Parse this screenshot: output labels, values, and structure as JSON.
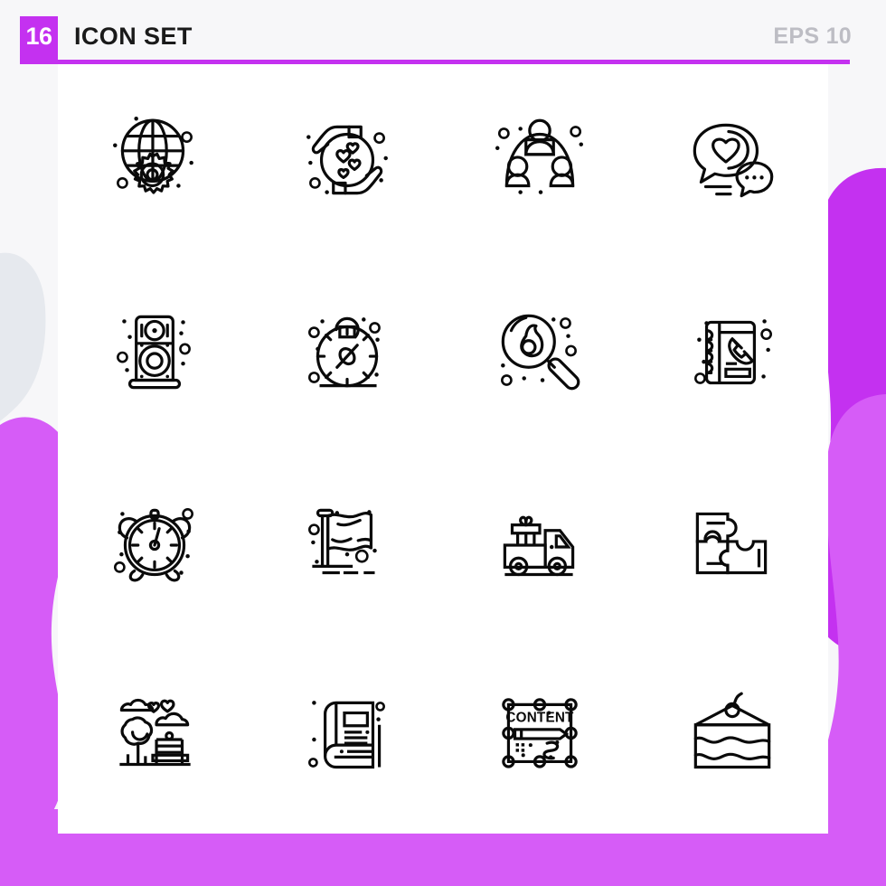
{
  "header": {
    "count_badge": "16",
    "title": "ICON SET",
    "eps_label": "EPS 10",
    "accent_color": "#c431f0",
    "title_color": "#1a1a1a",
    "eps_color": "#bdbdc4"
  },
  "canvas": {
    "background_color": "#f7f7f9",
    "sheet_color": "#ffffff",
    "blob_color_dark": "#c431f0",
    "blob_color_light": "#d65cf7",
    "blob_color_pale": "#e6e9ee",
    "stroke_color": "#0a0a0a"
  },
  "grid": {
    "columns": 4,
    "rows": 4,
    "total_icons": 16
  },
  "icons": [
    {
      "index": 1,
      "name": "global-settings-icon",
      "label": "Globe with gear"
    },
    {
      "index": 2,
      "name": "hands-care-hearts-icon",
      "label": "Hands holding hearts"
    },
    {
      "index": 3,
      "name": "team-group-icon",
      "label": "Group of three people"
    },
    {
      "index": 4,
      "name": "chat-heart-icon",
      "label": "Chat bubbles with heart"
    },
    {
      "index": 5,
      "name": "loudspeaker-icon",
      "label": "Studio speaker"
    },
    {
      "index": 6,
      "name": "pocket-compass-icon",
      "label": "Pocket watch compass"
    },
    {
      "index": 7,
      "name": "microscope-search-icon",
      "label": "Magnifier with cell"
    },
    {
      "index": 8,
      "name": "phone-book-icon",
      "label": "Contact book with handset"
    },
    {
      "index": 9,
      "name": "alarm-clock-icon",
      "label": "Alarm clock"
    },
    {
      "index": 10,
      "name": "flag-pole-icon",
      "label": "Waving flag on pole"
    },
    {
      "index": 11,
      "name": "gift-delivery-truck-icon",
      "label": "Truck carrying gift"
    },
    {
      "index": 12,
      "name": "puzzle-pieces-icon",
      "label": "Puzzle pieces"
    },
    {
      "index": 13,
      "name": "park-bench-tree-icon",
      "label": "Park with tree and bench"
    },
    {
      "index": 14,
      "name": "book-icon",
      "label": "Closed book"
    },
    {
      "index": 15,
      "name": "content-edit-icon",
      "label": "Content editing frame"
    },
    {
      "index": 16,
      "name": "cake-slice-icon",
      "label": "Slice of cake with cherry"
    }
  ],
  "icon_text": {
    "content_label": "CONTENT"
  }
}
